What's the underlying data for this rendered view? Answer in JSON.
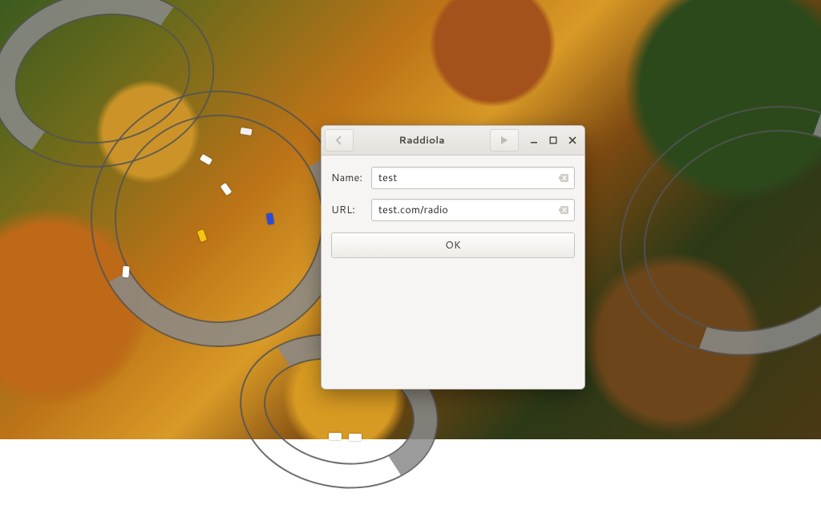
{
  "window": {
    "title": "Raddiola"
  },
  "form": {
    "name_label": "Name:",
    "name_value": "test",
    "url_label": "URL:",
    "url_value": "test.com/radio",
    "ok_label": "OK"
  }
}
